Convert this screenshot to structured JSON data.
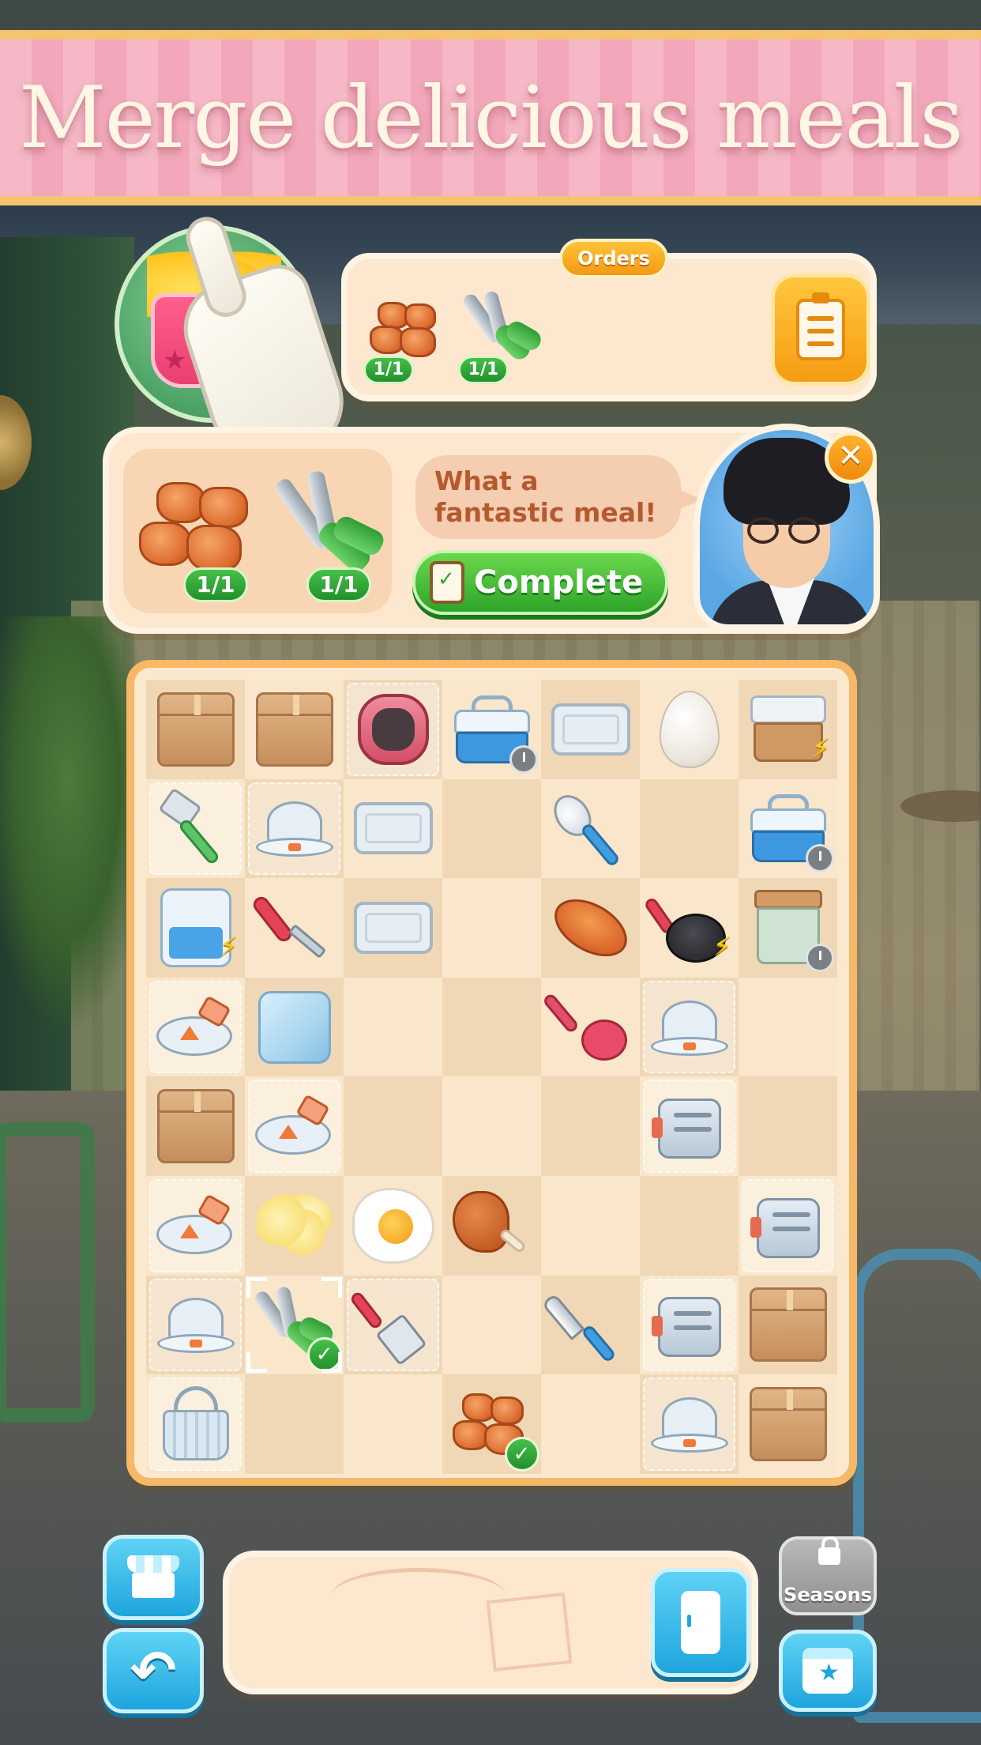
{
  "banner": {
    "title": "Merge delicious meals"
  },
  "orders": {
    "tag": "Orders",
    "items": [
      {
        "icon": "nuggets-icon",
        "qty": "1/1"
      },
      {
        "icon": "tongs-icon",
        "qty": "1/1"
      }
    ]
  },
  "order_detail": {
    "items": [
      {
        "icon": "nuggets-icon",
        "qty": "1/1"
      },
      {
        "icon": "tongs-icon",
        "qty": "1/1"
      }
    ],
    "speech_line1": "What a",
    "speech_line2": "fantastic meal!",
    "complete_label": "Complete"
  },
  "board": {
    "rows": [
      [
        "box",
        "box",
        "waffle-iron",
        "cooler",
        "tray",
        "egg",
        "drawer"
      ],
      [
        "mallet",
        "cloche",
        "tray",
        "",
        "spoon",
        "",
        "cooler"
      ],
      [
        "fridge",
        "scraper",
        "tray",
        "",
        "bread",
        "frying-pan",
        "cabinet"
      ],
      [
        "flyer",
        "ice-cube",
        "",
        "",
        "ladle",
        "cloche",
        ""
      ],
      [
        "box",
        "flyer",
        "",
        "",
        "",
        "toaster",
        ""
      ],
      [
        "flyer",
        "scrambled-eggs",
        "fried-egg",
        "drumstick",
        "",
        "",
        "toaster"
      ],
      [
        "cloche",
        "tongs",
        "spatula",
        "",
        "knife",
        "toaster",
        "box"
      ],
      [
        "basket",
        "",
        "",
        "nuggets",
        "",
        "cloche",
        "box"
      ]
    ]
  },
  "bottom": {
    "seasons_label": "Seasons"
  },
  "colors": {
    "banner_pink": "#f6b8c6",
    "panel_cream": "#fde7cf",
    "complete_green": "#2fa42a",
    "action_blue": "#1ea5dd",
    "orders_orange": "#f39a12"
  }
}
